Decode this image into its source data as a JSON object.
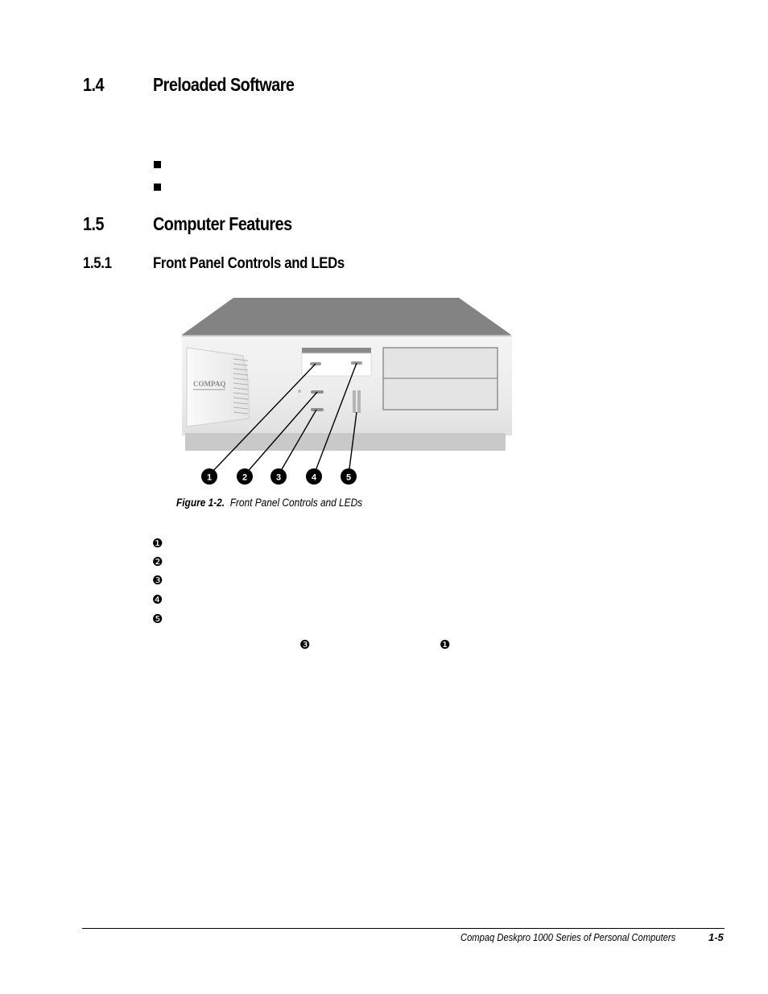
{
  "sections": {
    "s1_4": {
      "number": "1.4",
      "title": "Preloaded Software",
      "bullets": [
        "",
        ""
      ]
    },
    "s1_5": {
      "number": "1.5",
      "title": "Computer Features"
    },
    "s1_5_1": {
      "number": "1.5.1",
      "title": "Front Panel Controls and LEDs"
    }
  },
  "figure": {
    "label": "Figure 1-2.",
    "caption": "Front Panel Controls and LEDs",
    "brand_text": "COMPAQ",
    "callouts": [
      "1",
      "2",
      "3",
      "4",
      "5"
    ]
  },
  "callout_list": [
    {
      "glyph": "❶",
      "text": ""
    },
    {
      "glyph": "❷",
      "text": ""
    },
    {
      "glyph": "❸",
      "text": ""
    },
    {
      "glyph": "❹",
      "text": ""
    },
    {
      "glyph": "❺",
      "text": ""
    }
  ],
  "note_line": {
    "glyph_a": "❸",
    "glyph_b": "❶"
  },
  "footer": {
    "title": "Compaq Deskpro 1000 Series of Personal Computers",
    "page": "1-5"
  }
}
